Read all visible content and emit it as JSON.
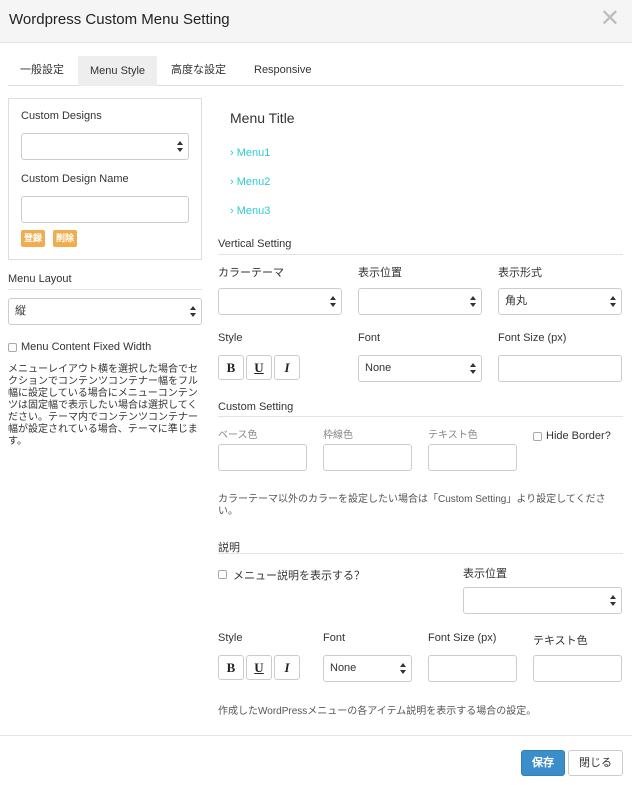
{
  "window": {
    "title": "Wordpress Custom Menu Setting",
    "close_icon": "close-icon"
  },
  "tabs": [
    {
      "label": "一般設定",
      "active": false
    },
    {
      "label": "Menu Style",
      "active": true
    },
    {
      "label": "高度な設定",
      "active": false
    },
    {
      "label": "Responsive",
      "active": false
    }
  ],
  "left": {
    "custom_designs_label": "Custom Designs",
    "custom_designs_value": "",
    "custom_design_name_label": "Custom Design Name",
    "custom_design_name_value": "",
    "register_button": "登録",
    "delete_button": "削除",
    "menu_layout_label": "Menu Layout",
    "menu_layout_value": "縦",
    "fixed_width_label": "Menu Content Fixed Width",
    "fixed_width_note": "メニューレイアウト横を選択した場合でセクションでコンテンツコンテナー幅をフル幅に設定している場合にメニューコンテンツは固定幅で表示したい場合は選択してください。テーマ内でコンテンツコンテナー幅が設定されている場合、テーマに準じます。"
  },
  "preview": {
    "title": "Menu Title",
    "items": [
      "Menu1",
      "Menu2",
      "Menu3"
    ],
    "chevron_icon": "chevron-right-icon"
  },
  "vertical": {
    "section_label": "Vertical Setting",
    "color_theme_label": "カラーテーマ",
    "color_theme_value": "",
    "position_label": "表示位置",
    "position_value": "",
    "display_format_label": "表示形式",
    "display_format_value": "角丸",
    "style_label": "Style",
    "font_label": "Font",
    "font_value": "None",
    "font_size_label": "Font Size (px)",
    "font_size_value": "",
    "bold": "B",
    "underline": "U",
    "italic": "I"
  },
  "custom": {
    "section_label": "Custom Setting",
    "base_color_label": "ベース色",
    "border_color_label": "枠線色",
    "text_color_label": "テキスト色",
    "hide_border_label": "Hide Border?",
    "note": "カラーテーマ以外のカラーを設定したい場合は「Custom Setting」より設定してください。"
  },
  "description": {
    "section_label": "説明",
    "show_label": "メニュー説明を表示する？",
    "position_label": "表示位置",
    "position_value": "",
    "style_label": "Style",
    "font_label": "Font",
    "font_value": "None",
    "font_size_label": "Font Size (px)",
    "text_color_label": "テキスト色",
    "bold": "B",
    "underline": "U",
    "italic": "I",
    "note": "作成したWordPressメニューの各アイテム説明を表示する場合の設定。"
  },
  "footer": {
    "save_button": "保存",
    "close_button": "閉じる"
  }
}
